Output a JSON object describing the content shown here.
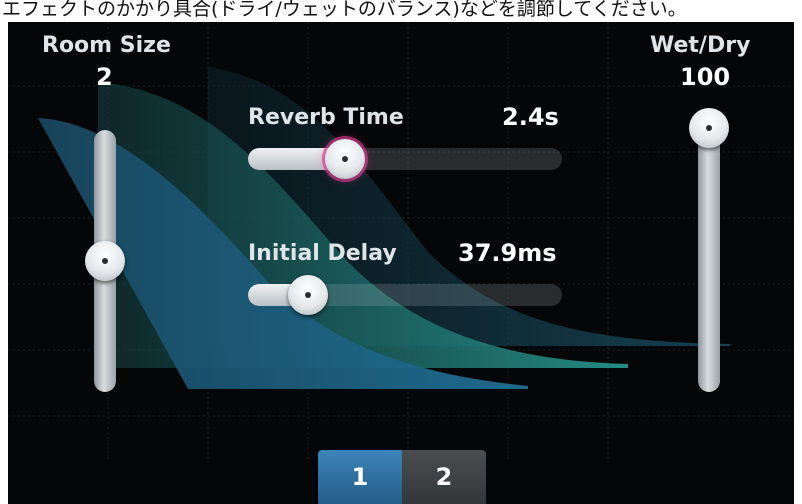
{
  "caption": "エフェクトのかかり具合(ドライ/ウェットのバランス)などを調節してください。",
  "room_size": {
    "label": "Room Size",
    "value": "2",
    "level": 0.5
  },
  "wet_dry": {
    "label": "Wet/Dry",
    "value": "100",
    "level": 1.0
  },
  "reverb_time": {
    "label": "Reverb Time",
    "value": "2.4s",
    "level": 0.3,
    "selected": true
  },
  "initial_delay": {
    "label": "Initial Delay",
    "value": "37.9ms",
    "level": 0.17
  },
  "pages": [
    {
      "label": "1",
      "selected": true
    },
    {
      "label": "2",
      "selected": false
    }
  ],
  "colors": {
    "accent": "#2f7fb3",
    "selected_ring": "#d63a8c",
    "background": "#050607"
  }
}
